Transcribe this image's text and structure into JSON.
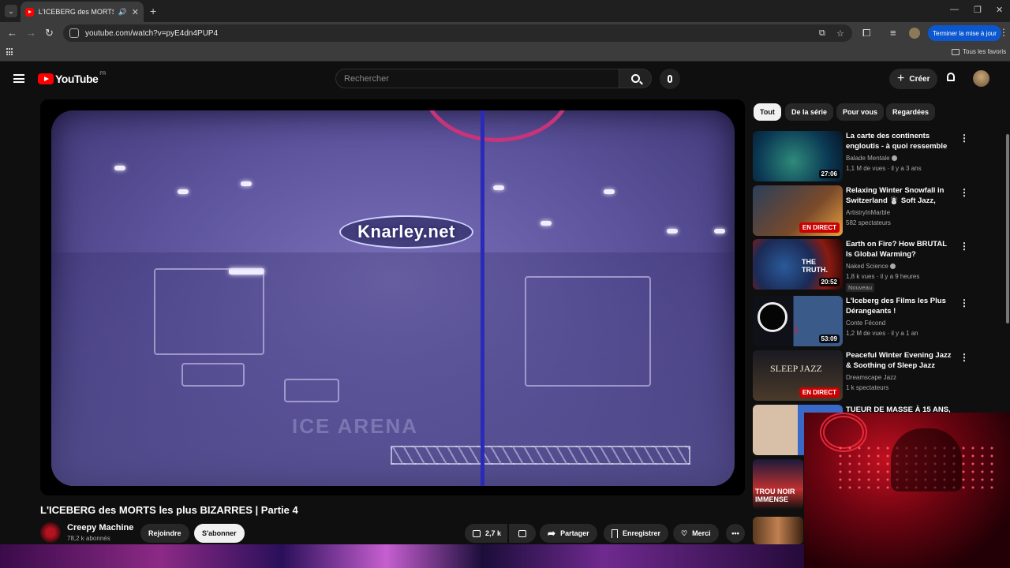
{
  "browser": {
    "tab_title": "L'ICEBERG des MORTS les plus BIZARRES | Partie 4",
    "url": "youtube.com/watch?v=pyE4dn4PUP4",
    "update_button": "Terminer la mise à jour",
    "bookmarks_folder": "Tous les favoris"
  },
  "header": {
    "logo_text": "YouTube",
    "logo_country": "FR",
    "search_placeholder": "Rechercher",
    "create_label": "Créer"
  },
  "video": {
    "watermark": "Knarley.net",
    "title": "L'ICEBERG des MORTS les plus BIZARRES | Partie 4",
    "channel": "Creepy Machine",
    "subscribers": "78,2 k abonnés",
    "join_label": "Rejoindre",
    "subscribe_label": "S'abonner",
    "likes": "2,7 k",
    "share_label": "Partager",
    "save_label": "Enregistrer",
    "thanks_label": "Merci"
  },
  "chips": [
    "Tout",
    "De la série",
    "Pour vous",
    "Regardées"
  ],
  "recommendations": [
    {
      "title": "La carte des continents engloutis - à quoi ressemble la...",
      "channel": "Balade Mentale",
      "verified": true,
      "meta": "1,1 M de vues · il y a 3 ans",
      "duration": "27:06",
      "live": "",
      "badge": ""
    },
    {
      "title": "Relaxing Winter Snowfall in Switzerland ☃️ Soft Jazz, Coz...",
      "channel": "ArtistryInMarble",
      "verified": false,
      "meta": "582 spectateurs",
      "duration": "",
      "live": "EN DIRECT",
      "badge": ""
    },
    {
      "title": "Earth on Fire? How BRUTAL Is Global Warming?",
      "channel": "Naked Science",
      "verified": true,
      "meta": "1,8 k vues · il y a 9 heures",
      "duration": "20:52",
      "live": "",
      "badge": "Nouveau",
      "thumb_text": "THE TRUTH."
    },
    {
      "title": "L'Iceberg des Films les Plus Dérangeants !",
      "channel": "Conte Fécond",
      "verified": false,
      "meta": "1,2 M de vues · il y a 1 an",
      "duration": "53:09",
      "live": "",
      "badge": ""
    },
    {
      "title": "Peaceful Winter Evening Jazz & Soothing of Sleep Jazz Piano ...",
      "channel": "Dreamscape Jazz",
      "verified": false,
      "meta": "1 k spectateurs",
      "duration": "",
      "live": "EN DIRECT",
      "badge": "",
      "thumb_text": "SLEEP JAZZ"
    },
    {
      "title": "TUEUR DE MASSE À 15 ANS,",
      "channel": "",
      "verified": false,
      "meta": "",
      "duration": "",
      "live": "",
      "badge": ""
    }
  ],
  "sidebar_partial_thumb_text": "TROU NOIR IMMENSE",
  "colors": {
    "accent": "#ff0000",
    "live": "#cc0000",
    "update": "#0b57d0"
  }
}
